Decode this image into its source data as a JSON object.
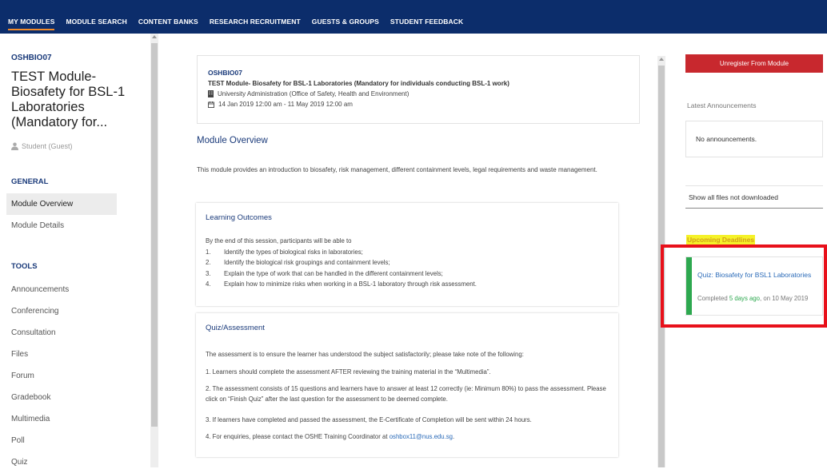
{
  "topnav": {
    "items": [
      "MY MODULES",
      "MODULE SEARCH",
      "CONTENT BANKS",
      "RESEARCH RECRUITMENT",
      "GUESTS & GROUPS",
      "STUDENT FEEDBACK"
    ],
    "active": "MY MODULES"
  },
  "sidebar": {
    "module_code": "OSHBIO07",
    "module_title": "TEST Module-Biosafety for BSL-1 Laboratories (Mandatory for...",
    "role": "Student (Guest)",
    "general_label": "GENERAL",
    "general_items": [
      "Module Overview",
      "Module Details"
    ],
    "tools_label": "TOOLS",
    "tools_items": [
      "Announcements",
      "Conferencing",
      "Consultation",
      "Files",
      "Forum",
      "Gradebook",
      "Multimedia",
      "Poll",
      "Quiz"
    ]
  },
  "header": {
    "code": "OSHBIO07",
    "name": "TEST Module- Biosafety for BSL-1 Laboratories (Mandatory for individuals conducting BSL-1 work)",
    "department": "University Administration (Office of Safety, Health and Environment)",
    "dates": "14 Jan 2019 12:00 am - 11 May 2019 12:00 am"
  },
  "overview": {
    "title": "Module Overview",
    "text": "This module provides an introduction to biosafety, risk management, different containment levels, legal requirements and waste management."
  },
  "learning_outcomes": {
    "title": "Learning Outcomes",
    "intro": "By the end of this session, participants will be able to",
    "items": [
      {
        "num": "1.",
        "text": "Identify the types of biological risks in laboratories;"
      },
      {
        "num": "2.",
        "text": "Identify the biological risk groupings and containment levels;"
      },
      {
        "num": "3.",
        "text": "Explain the type of work that can be handled in the different containment levels;"
      },
      {
        "num": "4.",
        "text": "Explain how to minimize risks when working in a BSL-1 laboratory through risk assessment."
      }
    ]
  },
  "quiz": {
    "title": "Quiz/Assessment",
    "p0": "The assessment is to ensure the learner has understood the subject satisfactorily;  please take note of the following:",
    "p1": "1. Learners should complete the assessment AFTER reviewing the training material in the “Multimedia”.",
    "p2": "2. The assessment consists of 15 questions and learners have to answer at least 12 correctly (ie: Minimum 80%) to pass the assessment. Please click on “Finish Quiz” after the last question for the assessment to be deemed complete.",
    "p3": "3. If learners have completed and passed the assessment, the E-Certificate of Completion will be sent within 24 hours.",
    "p4_prefix": "4. For enquiries, please contact the OSHE Training Coordinator at ",
    "p4_email": "oshbox11@nus.edu.sg",
    "p4_suffix": "."
  },
  "right": {
    "unregister_label": "Unregister From Module",
    "announcements_label": "Latest Announcements",
    "announcements_empty": "No announcements.",
    "files_label": "Show all files not downloaded",
    "deadlines_label": "Upcoming Deadlines",
    "deadline": {
      "title": "Quiz: Biosafety for BSL1 Laboratories",
      "status_prefix": "Completed ",
      "status_ago": "5 days ago",
      "status_suffix": ", on 10 May 2019"
    }
  },
  "colors": {
    "nav_bg": "#0c2d6b",
    "nav_active_underline": "#f28b2a",
    "link_blue": "#1a3a7a",
    "unregister_red": "#c8282e",
    "completed_green": "#2da84f",
    "highlight_yellow": "#f5f229",
    "annotation_red": "#e8101a"
  },
  "icons": {
    "role": "person-icon",
    "department": "building-icon",
    "dates": "calendar-icon"
  }
}
